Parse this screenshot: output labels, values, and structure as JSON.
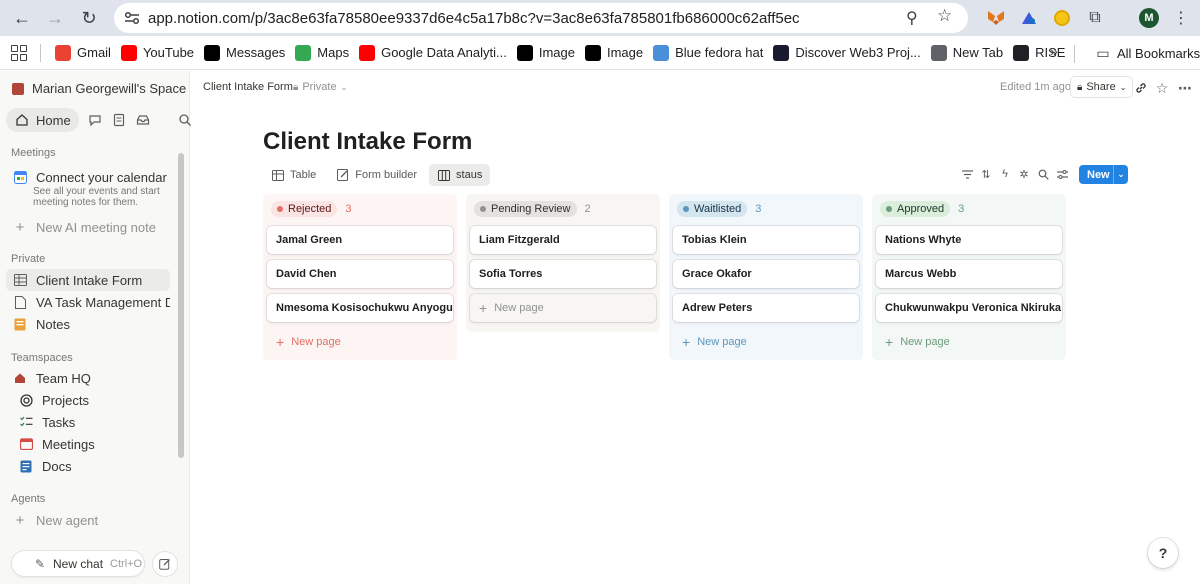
{
  "browser": {
    "url": "app.notion.com/p/3ac8e63fa78580ee9337d6e4c5a17b8c?v=3ac8e63fa785801fb686000c62aff5ec",
    "profile_initial": "M",
    "bookmarks": [
      {
        "label": "Gmail",
        "icon": "gmail-icon",
        "color": "#ea4335"
      },
      {
        "label": "YouTube",
        "icon": "youtube-icon",
        "color": "#ff0000"
      },
      {
        "label": "Messages",
        "icon": "x-icon",
        "color": "#000000"
      },
      {
        "label": "Maps",
        "icon": "maps-icon",
        "color": "#34a853"
      },
      {
        "label": "Google Data Analyti...",
        "icon": "youtube-icon",
        "color": "#ff0000"
      },
      {
        "label": "Image",
        "icon": "x-icon",
        "color": "#000000"
      },
      {
        "label": "Image",
        "icon": "x-icon",
        "color": "#000000"
      },
      {
        "label": "Blue fedora hat",
        "icon": "hat-icon",
        "color": "#4a90d9"
      },
      {
        "label": "Discover Web3 Proj...",
        "icon": "web3-icon",
        "color": "#1a1a2e"
      },
      {
        "label": "New Tab",
        "icon": "chrome-icon",
        "color": "#5f6368"
      },
      {
        "label": "RISE",
        "icon": "rise-icon",
        "color": "#202124"
      }
    ],
    "all_bookmarks": "All Bookmarks"
  },
  "sidebar": {
    "workspace": "Marian Georgewill's Space",
    "home": "Home",
    "meetings_section": "Meetings",
    "calendar_title": "Connect your calendar",
    "calendar_desc": "See all your events and start meeting notes for them.",
    "new_meeting_note": "New AI meeting note",
    "private_section": "Private",
    "private_items": [
      "Client Intake Form",
      "VA Task Management Dash...",
      "Notes"
    ],
    "teamspaces_section": "Teamspaces",
    "teamspace_items": [
      "Team HQ",
      "Projects",
      "Tasks",
      "Meetings",
      "Docs"
    ],
    "agents_section": "Agents",
    "new_agent": "New agent",
    "new_chat": "New chat",
    "new_chat_shortcut": "Ctrl+O"
  },
  "topbar": {
    "breadcrumb": "Client Intake Form",
    "privacy": "Private",
    "edited": "Edited 1m ago",
    "share": "Share"
  },
  "page": {
    "title": "Client Intake Form",
    "views": [
      "Table",
      "Form builder",
      "staus"
    ],
    "new_button": "New"
  },
  "board": {
    "new_page": "New page",
    "columns": [
      {
        "status": "Rejected",
        "count": "3",
        "bg": "#fdf5f3",
        "tag_bg": "#fbe4e4",
        "tag_fg": "#5d1715",
        "dot": "#e16f64",
        "accent": "#e16f64",
        "cards": [
          "Jamal Green",
          "David Chen",
          "Nmesoma Kosisochukwu Anyogu"
        ]
      },
      {
        "status": "Pending Review",
        "count": "2",
        "bg": "#f7f6f3",
        "tag_bg": "#e3e2e0",
        "tag_fg": "#32302c",
        "dot": "#91918e",
        "accent": "#91918e",
        "cards": [
          "Liam Fitzgerald",
          "Sofia Torres"
        ]
      },
      {
        "status": "Waitlisted",
        "count": "3",
        "bg": "#f2f7fb",
        "tag_bg": "#d3e5ef",
        "tag_fg": "#183347",
        "dot": "#5b97bd",
        "accent": "#5b97bd",
        "cards": [
          "Tobias Klein",
          "Grace Okafor",
          "Adrew Peters"
        ]
      },
      {
        "status": "Approved",
        "count": "3",
        "bg": "#f3f7f5",
        "tag_bg": "#dbeddb",
        "tag_fg": "#1c3829",
        "dot": "#6c9b7d",
        "accent": "#6c9b7d",
        "cards": [
          "Nations Whyte",
          "Marcus Webb",
          "Chukwunwakpu Veronica Nkiruka"
        ]
      }
    ]
  }
}
